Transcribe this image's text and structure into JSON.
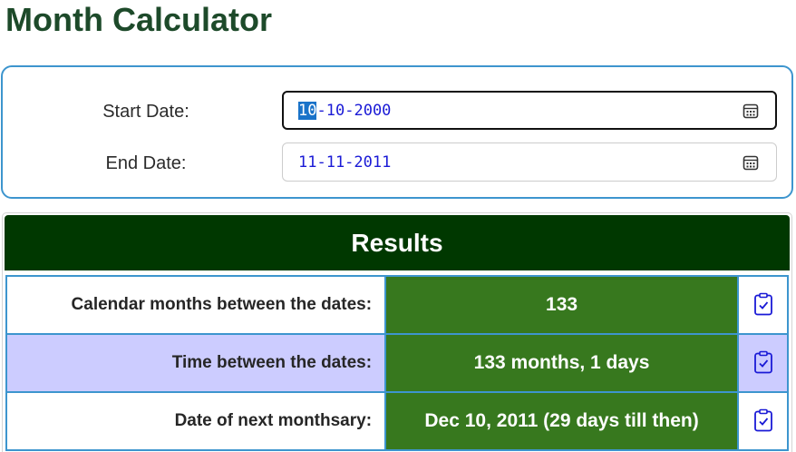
{
  "page": {
    "title": "Month Calculator"
  },
  "inputs": {
    "start": {
      "label": "Start Date:",
      "month": "10",
      "sep1": "-",
      "day": "10",
      "sep2": "-",
      "year": "2000",
      "selected_segment": "month",
      "icon": "calendar-icon"
    },
    "end": {
      "label": "End Date:",
      "value": "11-11-2011",
      "icon": "calendar-icon"
    }
  },
  "results": {
    "header": "Results",
    "rows": [
      {
        "label": "Calendar months between the dates:",
        "value": "133",
        "icon": "clipboard-check-icon"
      },
      {
        "label": "Time between the dates:",
        "value": "133 months, 1 days",
        "icon": "clipboard-check-icon"
      },
      {
        "label": "Date of next monthsary:",
        "value": "Dec 10, 2011 (29 days till then)",
        "icon": "clipboard-check-icon"
      }
    ]
  },
  "colors": {
    "title": "#1d4a2a",
    "panel_border": "#3d95ce",
    "results_header_bg": "#003800",
    "value_bg": "#37781e",
    "alt_row_bg": "#ccccff",
    "date_text": "#1a1ad6",
    "icon": "#1a1ad6"
  }
}
